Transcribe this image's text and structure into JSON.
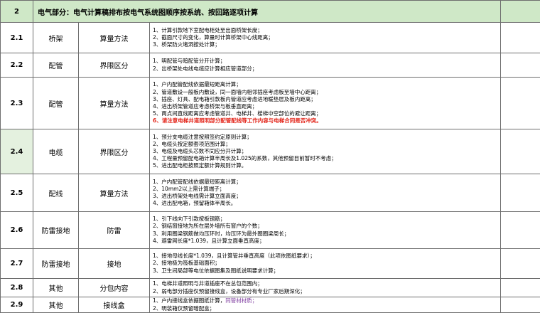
{
  "header": {
    "number": "2",
    "title": "电气部分：电气计算稿排布按电气系统图顺序按系统、按回路逐项计算"
  },
  "rows": [
    {
      "num": "2.1",
      "category": "桥架",
      "item": "算量方法",
      "lines": [
        "1、计算引款地下室配电柜处至出面桥架长度；",
        "2、截面尺寸的变化，算量时计算桥架中心线距离；",
        "3、桥架防火堵洞按处计算；"
      ]
    },
    {
      "num": "2.2",
      "category": "配管",
      "item": "界限区分",
      "lines": [
        "1、明配管与暗配管分开计算；",
        "2、出桥架处电线电缆应计算相应管道部分；"
      ]
    },
    {
      "num": "2.3",
      "category": "配管",
      "item": "算量方法",
      "lines": [
        "1、户内配管配线依据最短距离计算；",
        "2、管道敷设一般板内敷设，同一面墙内相邻插座考虑板至墙中心距离；",
        "3、插座、灯具、配电箱引款板内管道应考虑进地暖垫层及板内距离；",
        "4、进出桥架管道应考虑桥架与板垂直距离；",
        "5、两点间直线距离应考虑管道井、电梯井、楼梯中空部位的避让距离；",
        "6、请注意电梯井道照明部分配管配线等工作内容与电梯合同是否冲突。"
      ]
    },
    {
      "num": "2.4",
      "category": "电缆",
      "item": "界限区分",
      "lines": [
        "1、预分支电缆注意按照签约定原则计算；",
        "2、电缆头按定额套项范围计算；",
        "3、电缆及电缆头芯数不同应分开计算；",
        "4、工程量预留配电箱计算半周长及1.025的系数，其他预留目前暂时不考虑；",
        "5、进出配电柜按照定额计算规则计算。"
      ]
    },
    {
      "num": "2.5",
      "category": "配线",
      "item": "算量方法",
      "lines": [
        "1、户内配管配线依据最短距离计算；",
        "2、10mm2以上需计算端子；",
        "3、进出桥架处电线需计算立面高度；",
        "4、进出配电箱，预留箱体半周长。"
      ]
    },
    {
      "num": "2.6",
      "category": "防雷接地",
      "item": "防雷",
      "lines": [
        "1、引下线向下引款按板钢筋；",
        "2、钢结窗接地为所在层外墙所有窗户的个数；",
        "3、利用圈梁钢筋做均压环时，均压环为最外圈圈梁周长；",
        "4、避雷网长度*1.039，且计算立面垂直高度；"
      ]
    },
    {
      "num": "2.7",
      "category": "防雷接地",
      "item": "接地",
      "lines": [
        "1、接地母线长度*1.039，且计算管井垂直高度（此项依图纸要求）；",
        "2、接地极为筏板基础面积；",
        "3、卫生间局部等电位依据图集及图纸说明要求计算；"
      ]
    },
    {
      "num": "2.8",
      "category": "其他",
      "item": "分包内容",
      "lines": [
        "1、电梯井道照明与井道插座不在总包范围内；",
        "2、弱电部分插座仅预留接线盒，设备部分有专业厂家后期深化；"
      ]
    },
    {
      "num": "2.9",
      "category": "其他",
      "item": "接线盒",
      "lines": [
        "1、户内接线盒依据图纸计算，",
        "2、明装箱仅预留暗配盒；"
      ],
      "note": "同管材材质；"
    }
  ],
  "colors": {
    "header_bg": "#cfe8c7",
    "highlight_bg": "#e4f1df",
    "red": "#e3261b",
    "purple": "#7d3a9e",
    "border": "#6e6e6e"
  }
}
